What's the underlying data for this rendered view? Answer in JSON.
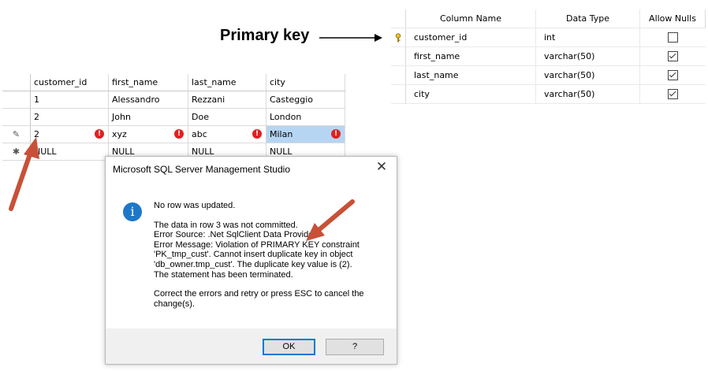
{
  "callout": {
    "label": "Primary key"
  },
  "design": {
    "headers": [
      "Column Name",
      "Data Type",
      "Allow Nulls"
    ],
    "rows": [
      {
        "name": "customer_id",
        "type": "int",
        "allow_nulls": false,
        "primary_key": true
      },
      {
        "name": "first_name",
        "type": "varchar(50)",
        "allow_nulls": true,
        "primary_key": false
      },
      {
        "name": "last_name",
        "type": "varchar(50)",
        "allow_nulls": true,
        "primary_key": false
      },
      {
        "name": "city",
        "type": "varchar(50)",
        "allow_nulls": true,
        "primary_key": false
      }
    ]
  },
  "grid": {
    "headers": [
      "customer_id",
      "first_name",
      "last_name",
      "city"
    ],
    "rows": [
      [
        "1",
        "Alessandro",
        "Rezzani",
        "Casteggio"
      ],
      [
        "2",
        "John",
        "Doe",
        "London"
      ],
      [
        "2",
        "xyz",
        "abc",
        "Milan"
      ],
      [
        "NULL",
        "NULL",
        "NULL",
        "NULL"
      ]
    ],
    "row_markers": [
      "",
      "",
      "✎",
      "✱"
    ],
    "error_glyph": "!"
  },
  "dialog": {
    "title": "Microsoft SQL Server Management Studio",
    "close": "✕",
    "icon": "i",
    "heading": "No row was updated.",
    "lines": [
      "The data in row 3 was not committed.",
      "Error Source: .Net SqlClient Data Provider.",
      "Error Message: Violation of PRIMARY KEY constraint",
      "'PK_tmp_cust'. Cannot insert duplicate key in object",
      "'db_owner.tmp_cust'. The duplicate key value is (2).",
      "The statement has been terminated."
    ],
    "footer_text": [
      "Correct the errors and retry or press ESC to cancel the",
      "change(s)."
    ],
    "ok_label": "OK",
    "help_label": "?"
  },
  "colors": {
    "arrow_red": "#c85038",
    "selection_blue": "#b6d5f2",
    "info_blue": "#1e78c8"
  }
}
